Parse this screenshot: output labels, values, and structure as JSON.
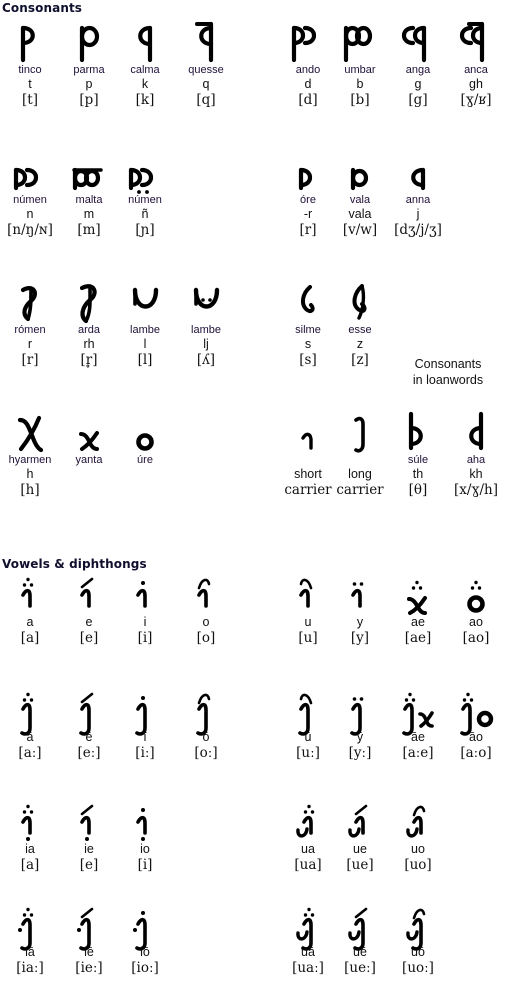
{
  "sections": [
    {
      "id": "consonants",
      "title": "Consonants",
      "note": "Consonants\nin loanwords"
    },
    {
      "id": "vowels",
      "title": "Vowels & diphthongs"
    }
  ],
  "consonants": {
    "row1": [
      {
        "glyph": "tinco-glyph",
        "name": "tinco",
        "translit": "t",
        "ipa": "[t]"
      },
      {
        "glyph": "parma-glyph",
        "name": "parma",
        "translit": "p",
        "ipa": "[p]"
      },
      {
        "glyph": "calma-glyph",
        "name": "calma",
        "translit": "k",
        "ipa": "[k]"
      },
      {
        "glyph": "quesse-glyph",
        "name": "quesse",
        "translit": "q",
        "ipa": "[q]"
      },
      {
        "glyph": "ando-glyph",
        "name": "ando",
        "translit": "d",
        "ipa": "[d]"
      },
      {
        "glyph": "umbar-glyph",
        "name": "umbar",
        "translit": "b",
        "ipa": "[b]"
      },
      {
        "glyph": "anga-glyph",
        "name": "anga",
        "translit": "g",
        "ipa": "[g]"
      },
      {
        "glyph": "anca-glyph",
        "name": "anca",
        "translit": "gh",
        "ipa": "[ɣ/ʁ]"
      }
    ],
    "row2": [
      {
        "glyph": "numen-glyph",
        "name": "númen",
        "translit": "n",
        "ipa": "[n/ŋ/ɴ]"
      },
      {
        "glyph": "malta-glyph",
        "name": "malta",
        "translit": "m",
        "ipa": "[m]"
      },
      {
        "glyph": "numen-dotted-glyph",
        "name": "númen",
        "translit": "ñ",
        "ipa": "[ɲ]"
      },
      {
        "glyph": "",
        "name": "",
        "translit": "",
        "ipa": ""
      },
      {
        "glyph": "ore-glyph",
        "name": "óre",
        "translit": "-r",
        "ipa": "[r]"
      },
      {
        "glyph": "vala-glyph",
        "name": "vala",
        "translit": "vala",
        "ipa": "[v/w]"
      },
      {
        "glyph": "anna-glyph",
        "name": "anna",
        "translit": "j",
        "ipa": "[dʒ/j/ʒ]"
      },
      {
        "glyph": "",
        "name": "",
        "translit": "",
        "ipa": ""
      }
    ],
    "row3": [
      {
        "glyph": "romen-glyph",
        "name": "rómen",
        "translit": "r",
        "ipa": "[r]"
      },
      {
        "glyph": "arda-glyph",
        "name": "arda",
        "translit": "rh",
        "ipa": "[r̥]"
      },
      {
        "glyph": "lambe-glyph",
        "name": "lambe",
        "translit": "l",
        "ipa": "[l]"
      },
      {
        "glyph": "lambe-dotted-glyph",
        "name": "lambe",
        "translit": "lj",
        "ipa": "[ʎ]"
      },
      {
        "glyph": "silme-glyph",
        "name": "silme",
        "translit": "s",
        "ipa": "[s]"
      },
      {
        "glyph": "esse-glyph",
        "name": "esse",
        "translit": "z",
        "ipa": "[z]"
      },
      {
        "glyph": "",
        "name": "",
        "translit": "",
        "ipa": ""
      },
      {
        "glyph": "",
        "name": "",
        "translit": "",
        "ipa": ""
      }
    ],
    "row4": [
      {
        "glyph": "hyarmen-glyph",
        "name": "hyarmen",
        "translit": "h",
        "ipa": "[h]"
      },
      {
        "glyph": "yanta-glyph",
        "name": "yanta",
        "translit": "",
        "ipa": ""
      },
      {
        "glyph": "ure-glyph",
        "name": "úre",
        "translit": "",
        "ipa": ""
      },
      {
        "glyph": "",
        "name": "",
        "translit": "",
        "ipa": ""
      },
      {
        "glyph": "short-carrier-glyph",
        "name": "",
        "translit": "short",
        "ipa": "carrier"
      },
      {
        "glyph": "long-carrier-glyph",
        "name": "",
        "translit": "long",
        "ipa": "carrier"
      },
      {
        "glyph": "sule-glyph",
        "name": "súle",
        "translit": "th",
        "ipa": "[θ]"
      },
      {
        "glyph": "aha-glyph",
        "name": "aha",
        "translit": "kh",
        "ipa": "[x/ɣ/h]"
      }
    ]
  },
  "vowels": {
    "row1": [
      {
        "glyph": "tehta-a-glyph",
        "translit": "a",
        "ipa": "[a]"
      },
      {
        "glyph": "tehta-e-glyph",
        "translit": "e",
        "ipa": "[e]"
      },
      {
        "glyph": "tehta-i-glyph",
        "translit": "i",
        "ipa": "[i]"
      },
      {
        "glyph": "tehta-o-glyph",
        "translit": "o",
        "ipa": "[o]"
      },
      {
        "glyph": "tehta-u-glyph",
        "translit": "u",
        "ipa": "[u]"
      },
      {
        "glyph": "tehta-y-glyph",
        "translit": "y",
        "ipa": "[y]"
      },
      {
        "glyph": "diph-ae-glyph",
        "translit": "ae",
        "ipa": "[ae]"
      },
      {
        "glyph": "diph-ao-glyph",
        "translit": "ao",
        "ipa": "[ao]"
      }
    ],
    "row2": [
      {
        "glyph": "long-a-glyph",
        "translit": "ā",
        "ipa": "[aː]"
      },
      {
        "glyph": "long-e-glyph",
        "translit": "ē",
        "ipa": "[eː]"
      },
      {
        "glyph": "long-i-glyph",
        "translit": "ī",
        "ipa": "[iː]"
      },
      {
        "glyph": "long-o-glyph",
        "translit": "ō",
        "ipa": "[oː]"
      },
      {
        "glyph": "long-u-glyph",
        "translit": "ū",
        "ipa": "[uː]"
      },
      {
        "glyph": "long-y-glyph",
        "translit": "ȳ",
        "ipa": "[yː]"
      },
      {
        "glyph": "long-ae-glyph",
        "translit": "āe",
        "ipa": "[aːe]"
      },
      {
        "glyph": "long-ao-glyph",
        "translit": "āo",
        "ipa": "[aːo]"
      }
    ],
    "row3": [
      {
        "glyph": "ia-glyph",
        "translit": "ia",
        "ipa": "[a]"
      },
      {
        "glyph": "ie-glyph",
        "translit": "ie",
        "ipa": "[e]"
      },
      {
        "glyph": "io-glyph",
        "translit": "io",
        "ipa": "[i]"
      },
      {
        "glyph": "",
        "translit": "",
        "ipa": ""
      },
      {
        "glyph": "ua-glyph",
        "translit": "ua",
        "ipa": "[ua]"
      },
      {
        "glyph": "ue-glyph",
        "translit": "ue",
        "ipa": "[ue]"
      },
      {
        "glyph": "uo-glyph",
        "translit": "uo",
        "ipa": "[uo]"
      },
      {
        "glyph": "",
        "translit": "",
        "ipa": ""
      }
    ],
    "row4": [
      {
        "glyph": "ia-long-glyph",
        "translit": "iā",
        "ipa": "[iaː]"
      },
      {
        "glyph": "ie-long-glyph",
        "translit": "iē",
        "ipa": "[ieː]"
      },
      {
        "glyph": "io-long-glyph",
        "translit": "iō",
        "ipa": "[ioː]"
      },
      {
        "glyph": "",
        "translit": "",
        "ipa": ""
      },
      {
        "glyph": "ua-long-glyph",
        "translit": "uā",
        "ipa": "[uaː]"
      },
      {
        "glyph": "ue-long-glyph",
        "translit": "uē",
        "ipa": "[ueː]"
      },
      {
        "glyph": "uo-long-glyph",
        "translit": "uō",
        "ipa": "[uoː]"
      },
      {
        "glyph": "",
        "translit": "",
        "ipa": ""
      }
    ]
  },
  "colors": {
    "heading": "#10102e",
    "name": "#1f1038",
    "text": "#111111",
    "background": "#ffffff"
  }
}
